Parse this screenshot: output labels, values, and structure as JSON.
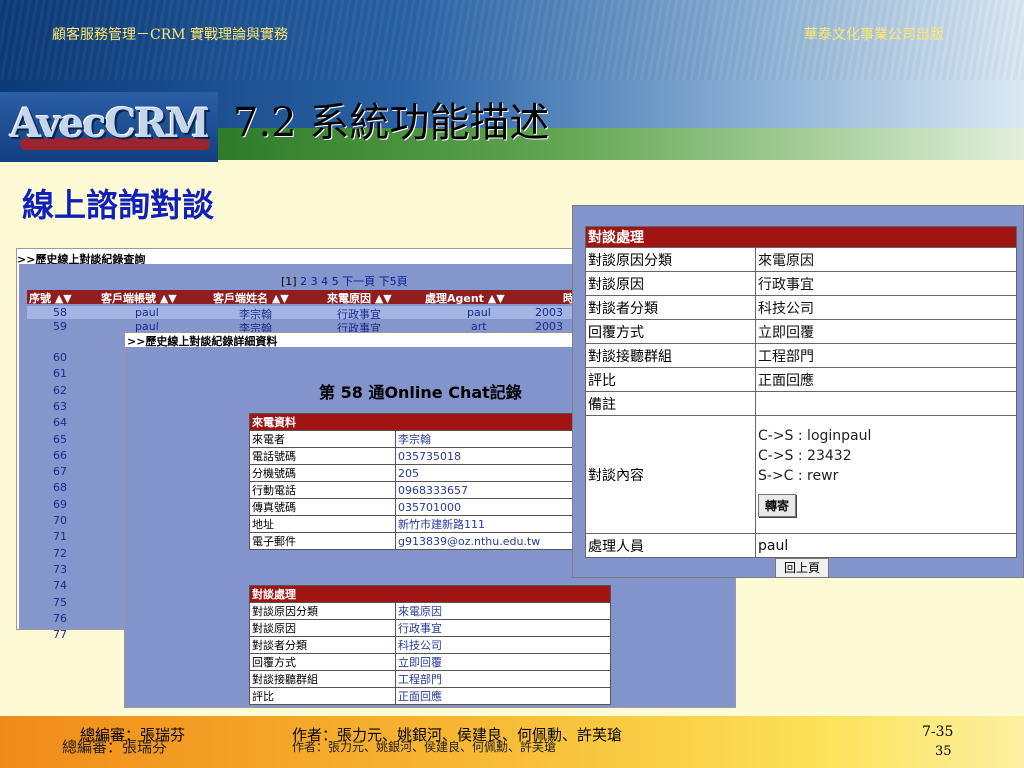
{
  "header": {
    "left_text": "顧客服務管理－CRM 實戰理論與實務",
    "right_text": "華泰文化事業公司出版",
    "logo_text": "AvecCRM",
    "title": "7.2 系統功能描述"
  },
  "subtitle": "線上諮詢對談",
  "history_window": {
    "title": ">>歷史線上對談紀錄查詢",
    "pager": {
      "current": "[1]",
      "rest": "2 3 4 5 下一頁 下5頁"
    },
    "columns": [
      "序號 ▲▼",
      "客戶端帳號 ▲▼",
      "客戶端姓名 ▲▼",
      "來電原因 ▲▼",
      "處理Agent ▲▼",
      "時"
    ],
    "rows": [
      {
        "id": "58",
        "account": "paul",
        "name": "李宗翰",
        "reason": "行政事宜",
        "agent": "paul",
        "date": "2003"
      },
      {
        "id": "59",
        "account": "paul",
        "name": "李宗翰",
        "reason": "行政事宜",
        "agent": "art",
        "date": "2003"
      }
    ],
    "numbers": [
      "60",
      "61",
      "62",
      "63",
      "64",
      "65",
      "66",
      "67",
      "68",
      "69",
      "70",
      "71",
      "72",
      "73",
      "74",
      "75",
      "76",
      "77"
    ]
  },
  "detail_window": {
    "title": ">>歷史線上對談紀錄詳細資料",
    "heading_prefix": "第",
    "heading_number": "58",
    "heading_suffix": "通Online Chat記錄",
    "caller_section": {
      "header": "來電資料",
      "rows": [
        {
          "label": "來電者",
          "value": "李宗翰"
        },
        {
          "label": "電話號碼",
          "value": "035735018"
        },
        {
          "label": "分機號碼",
          "value": "205"
        },
        {
          "label": "行動電話",
          "value": "0968333657"
        },
        {
          "label": "傳真號碼",
          "value": "035701000"
        },
        {
          "label": "地址",
          "value": "新竹市建新路111"
        },
        {
          "label": "電子郵件",
          "value": "g913839@oz.nthu.edu.tw"
        }
      ]
    },
    "handling_section": {
      "header": "對談處理",
      "rows": [
        {
          "label": "對談原因分類",
          "value": "來電原因"
        },
        {
          "label": "對談原因",
          "value": "行政事宜"
        },
        {
          "label": "對談者分類",
          "value": "科技公司"
        },
        {
          "label": "回覆方式",
          "value": "立即回覆"
        },
        {
          "label": "對談接聽群組",
          "value": "工程部門"
        },
        {
          "label": "評比",
          "value": "正面回應"
        }
      ]
    }
  },
  "handling_window": {
    "header": "對談處理",
    "rows": [
      {
        "label": "對談原因分類",
        "value": "來電原因"
      },
      {
        "label": "對談原因",
        "value": "行政事宜"
      },
      {
        "label": "對談者分類",
        "value": "科技公司"
      },
      {
        "label": "回覆方式",
        "value": "立即回覆"
      },
      {
        "label": "對談接聽群組",
        "value": "工程部門"
      },
      {
        "label": "評比",
        "value": "正面回應"
      },
      {
        "label": "備註",
        "value": ""
      }
    ],
    "content_label": "對談內容",
    "content_lines": [
      "C->S : loginpaul",
      "C->S : 23432",
      "S->C : rewr"
    ],
    "forward_button": "轉寄",
    "handler_label": "處理人員",
    "handler_value": "paul",
    "back_button": "回上頁"
  },
  "footer": {
    "editor_top": "總編審：張瑞芬",
    "editor_bottom": "總編審：張瑞芬",
    "authors_top": "作者：張力元、姚銀河、侯建良、何佩勳、許芙瑲",
    "authors_bottom": "作者：張力元、姚銀河、侯建良、何佩勳、許芙瑲",
    "page_top": "7-35",
    "page_bottom": "35"
  }
}
